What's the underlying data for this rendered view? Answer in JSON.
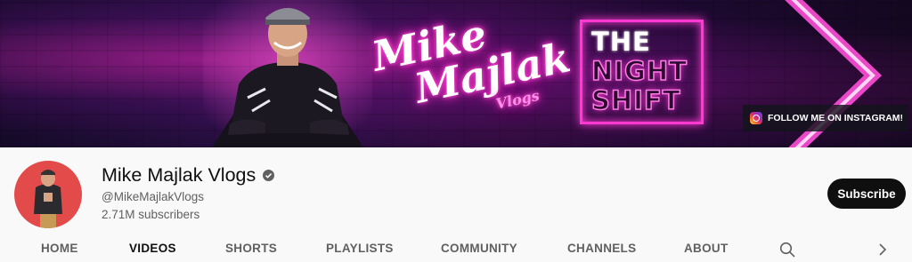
{
  "banner": {
    "logo_first": "Mike",
    "logo_last": "Majlak",
    "logo_vlogs": "Vlogs",
    "show_line1": "THE",
    "show_line2": "NIGHT",
    "show_line3": "SHIFT",
    "instagram_link": "FOLLOW ME ON INSTAGRAM!"
  },
  "channel": {
    "name": "Mike Majlak Vlogs",
    "verified_icon": "verified-check-icon",
    "handle": "@MikeMajlakVlogs",
    "subscribers": "2.71M subscribers",
    "subscribe_label": "Subscribe"
  },
  "tabs": [
    {
      "label": "HOME",
      "active": false
    },
    {
      "label": "VIDEOS",
      "active": true
    },
    {
      "label": "SHORTS",
      "active": false
    },
    {
      "label": "PLAYLISTS",
      "active": false
    },
    {
      "label": "COMMUNITY",
      "active": false
    },
    {
      "label": "CHANNELS",
      "active": false
    },
    {
      "label": "ABOUT",
      "active": false
    }
  ],
  "icons": {
    "search": "search-icon",
    "next": "chevron-right-icon"
  },
  "colors": {
    "accent_pink": "#ff39d2",
    "subscribe_bg": "#0f0f0f",
    "avatar_bg": "#e34a4a"
  }
}
